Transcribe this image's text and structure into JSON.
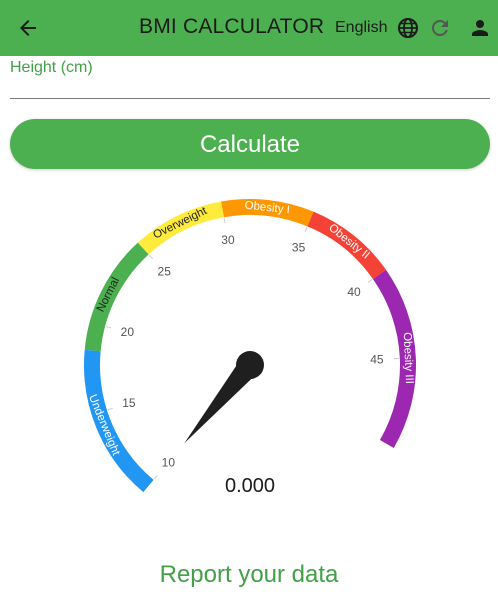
{
  "appbar": {
    "title": "BMI CALCULATOR",
    "language": "English",
    "icons": {
      "back": "arrow-back-icon",
      "globe": "globe-icon",
      "refresh": "refresh-icon",
      "account": "person-icon"
    }
  },
  "form": {
    "height_label": "Height (cm)",
    "height_value": "",
    "calculate_label": "Calculate"
  },
  "gauge": {
    "value": 0,
    "value_text": "0.000",
    "min": 10,
    "max": 50,
    "ticks": [
      "10",
      "15",
      "20",
      "25",
      "30",
      "35",
      "40",
      "45"
    ],
    "tick_values": [
      10,
      15,
      20,
      25,
      30,
      35,
      40,
      45
    ],
    "bands": [
      {
        "name": "Underweight",
        "from": 10,
        "to": 18.5,
        "color": "#2196f3"
      },
      {
        "name": "Normal",
        "from": 18.5,
        "to": 25,
        "color": "#4caf50"
      },
      {
        "name": "Overweight",
        "from": 25,
        "to": 30,
        "color": "#ffeb3b"
      },
      {
        "name": "Obesity I",
        "from": 30,
        "to": 35,
        "color": "#ff9800"
      },
      {
        "name": "Obesity II",
        "from": 35,
        "to": 40,
        "color": "#f44336"
      },
      {
        "name": "Obesity III",
        "from": 40,
        "to": 50,
        "color": "#9c27b0"
      }
    ]
  },
  "footer": {
    "report_label": "Report your data"
  },
  "colors": {
    "primary": "#4caf50",
    "accent_text": "#43a047",
    "needle": "#1f1f1f"
  }
}
